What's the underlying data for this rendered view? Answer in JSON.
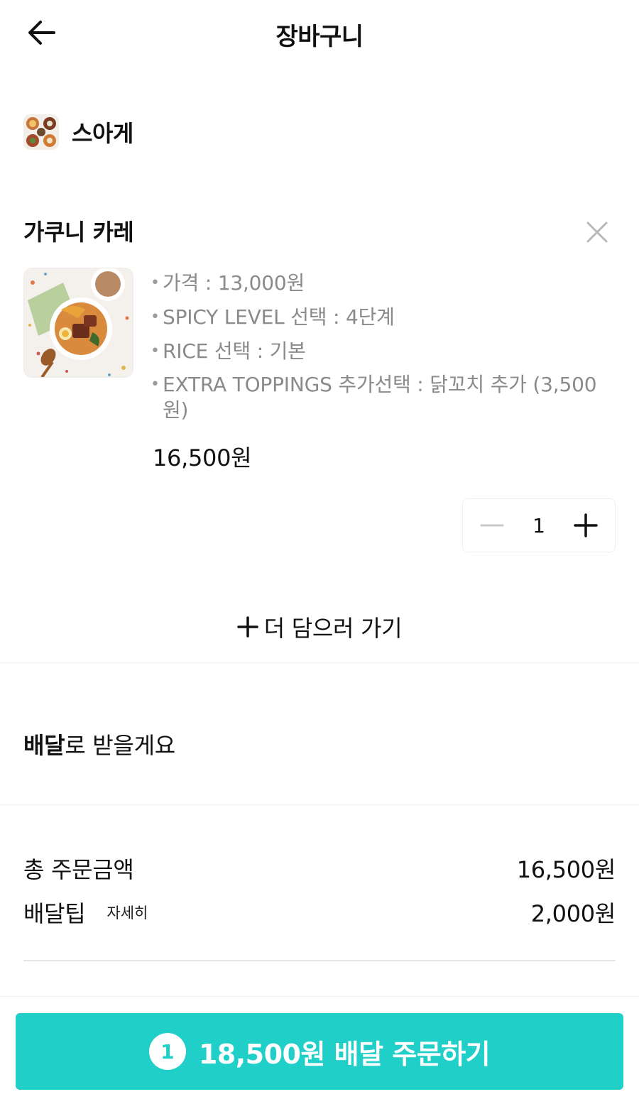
{
  "header": {
    "title": "장바구니",
    "back_icon": "arrow-left-icon"
  },
  "store": {
    "name": "스아게",
    "logo_icon": "store-logo"
  },
  "item": {
    "name": "가쿠니 카레",
    "remove_icon": "close-icon",
    "options": [
      "가격 : 13,000원",
      "SPICY LEVEL 선택 : 4단계",
      "RICE 선택 : 기본",
      "EXTRA TOPPINGS 추가선택 : 닭꼬치 추가 (3,500원)"
    ],
    "price": "16,500원",
    "quantity": "1"
  },
  "add_more": {
    "label": "더 담으러 가기",
    "icon": "plus-icon"
  },
  "delivery": {
    "mode_bold": "배달",
    "mode_rest": "로 받을게요"
  },
  "summary": {
    "total_label": "총 주문금액",
    "total_value": "16,500원",
    "tip_label": "배달팁",
    "tip_detail": "자세히",
    "tip_value": "2,000원"
  },
  "order_button": {
    "count": "1",
    "label": "18,500원 배달 주문하기"
  },
  "colors": {
    "accent": "#21cfc9",
    "muted_text": "#8a8a8a"
  }
}
